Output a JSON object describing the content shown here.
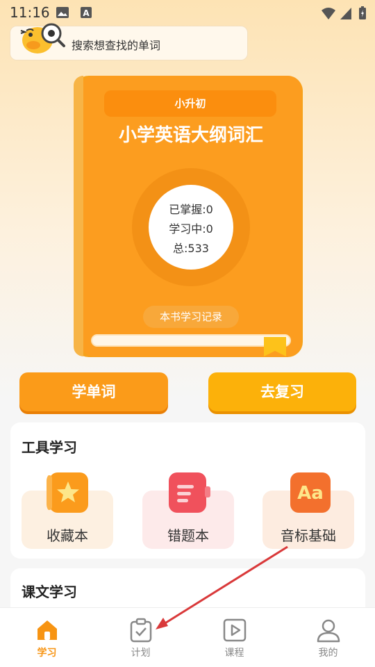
{
  "status": {
    "time": "11:16"
  },
  "search": {
    "placeholder": "搜索想查找的单词"
  },
  "book": {
    "tag": "小升初",
    "title": "小学英语大纲词汇",
    "mastered": "已掌握:0",
    "learning": "学习中:0",
    "total": "总:533",
    "record_label": "本书学习记录",
    "progress": 0
  },
  "actions": {
    "learn_label": "学单词",
    "review_label": "去复习"
  },
  "tools": {
    "title": "工具学习",
    "items": [
      {
        "label": "收藏本",
        "icon": "star-folder-icon"
      },
      {
        "label": "错题本",
        "icon": "notebook-icon"
      },
      {
        "label": "音标基础",
        "icon": "phonetics-aa-icon"
      }
    ]
  },
  "lessons": {
    "title": "课文学习"
  },
  "tabbar": {
    "items": [
      {
        "label": "学习",
        "icon": "home-icon",
        "active": true
      },
      {
        "label": "计划",
        "icon": "clipboard-check-icon",
        "active": false
      },
      {
        "label": "课程",
        "icon": "play-video-icon",
        "active": false
      },
      {
        "label": "我的",
        "icon": "user-icon",
        "active": false
      }
    ]
  },
  "colors": {
    "accent": "#fc9d1f",
    "active_tab": "#f79413",
    "annotation_arrow": "#d9393a"
  }
}
